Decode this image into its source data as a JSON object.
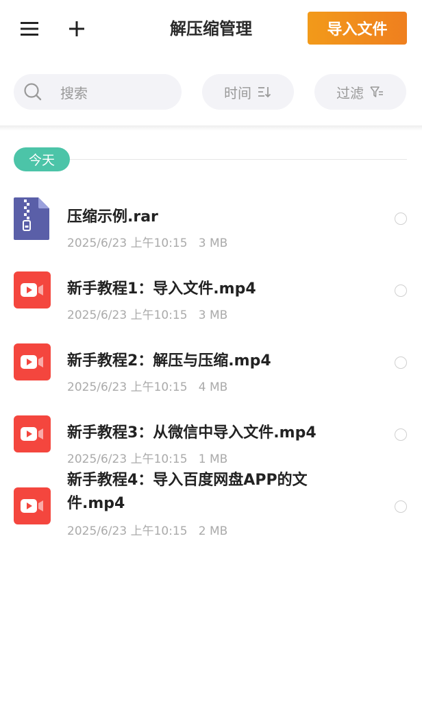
{
  "header": {
    "title": "解压缩管理",
    "import_label": "导入文件"
  },
  "toolbar": {
    "search_placeholder": "搜索",
    "time_label": "时间",
    "filter_label": "过滤"
  },
  "section": {
    "today_label": "今天"
  },
  "files": [
    {
      "name": "压缩示例.rar",
      "date": "2025/6/23 上午10:15",
      "size": "3 MB",
      "icon": "zip-file-icon"
    },
    {
      "name": "新手教程1：导入文件.mp4",
      "date": "2025/6/23 上午10:15",
      "size": "3 MB",
      "icon": "video-file-icon"
    },
    {
      "name": "新手教程2：解压与压缩.mp4",
      "date": "2025/6/23 上午10:15",
      "size": "4 MB",
      "icon": "video-file-icon"
    },
    {
      "name": "新手教程3：从微信中导入文件.mp4",
      "date": "2025/6/23 上午10:15",
      "size": "1 MB",
      "icon": "video-file-icon"
    },
    {
      "name": "新手教程4：导入百度网盘APP的文件.mp4",
      "date": "2025/6/23 上午10:15",
      "size": "2 MB",
      "icon": "video-file-icon"
    }
  ],
  "colors": {
    "accent": "#ef8a1d",
    "today_chip": "#4cc4a8",
    "video_icon": "#f4463e",
    "zip_icon": "#5a5fa8"
  }
}
